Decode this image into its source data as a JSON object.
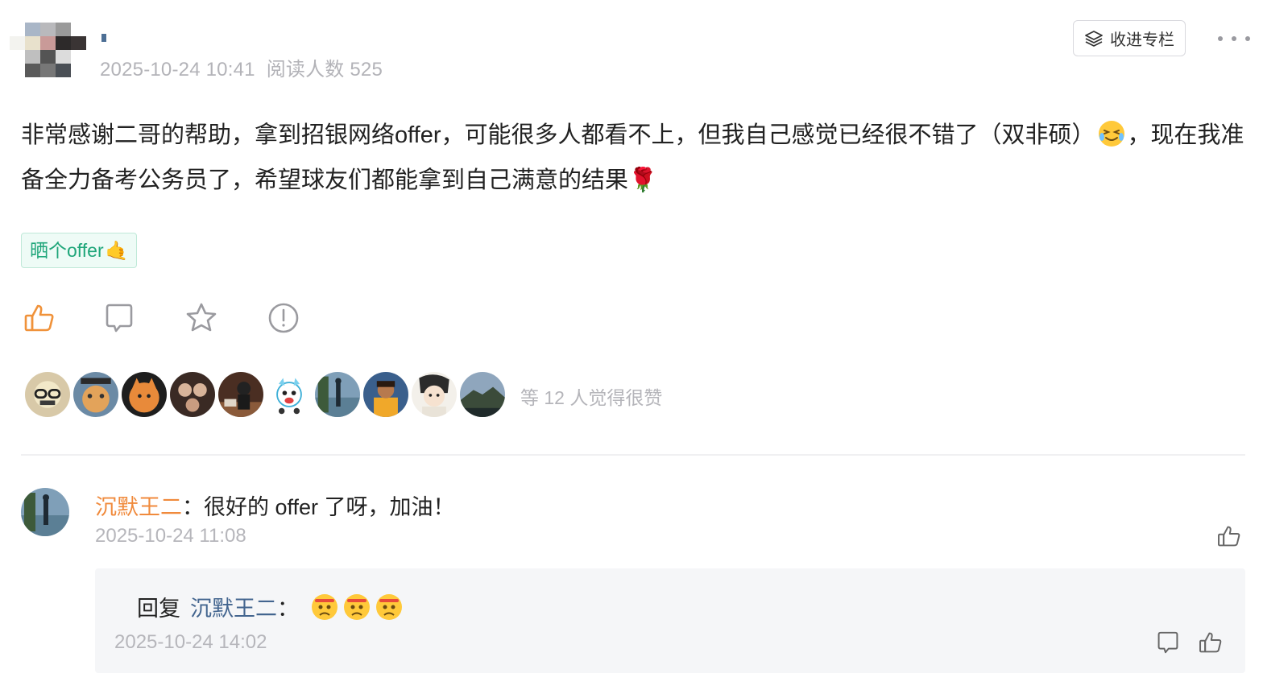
{
  "header": {
    "meta_time": "2025-10-24 10:41",
    "meta_reads": "阅读人数 525",
    "collect_label": "收进专栏"
  },
  "post": {
    "text_part1": "非常感谢二哥的帮助，拿到招银网络offer，可能很多人都看不上，但我自己感觉已经很不错了（双非硕）",
    "text_part2": "，现在我准备全力备考公务员了，希望球友们都能拿到自己满意的结果",
    "tag_label": "晒个offer",
    "tag_emoji": "🤙",
    "rose_emoji": "🌹"
  },
  "actions": {
    "icons": [
      "thumbs-up-icon",
      "comment-icon",
      "star-icon",
      "report-icon"
    ]
  },
  "likers": {
    "summary": "等 12 人觉得很赞"
  },
  "comment": {
    "user": "沉默王二",
    "separator": "：",
    "text": "很好的 offer 了呀，加油！",
    "time": "2025-10-24 11:08",
    "reply": {
      "prefix": "回复",
      "user": "沉默王二",
      "separator": "：",
      "time": "2025-10-24 14:02"
    }
  },
  "colors": {
    "accent_orange": "#f08a3c",
    "tag_green": "#1fa67a",
    "reply_user_blue": "#43658f"
  }
}
